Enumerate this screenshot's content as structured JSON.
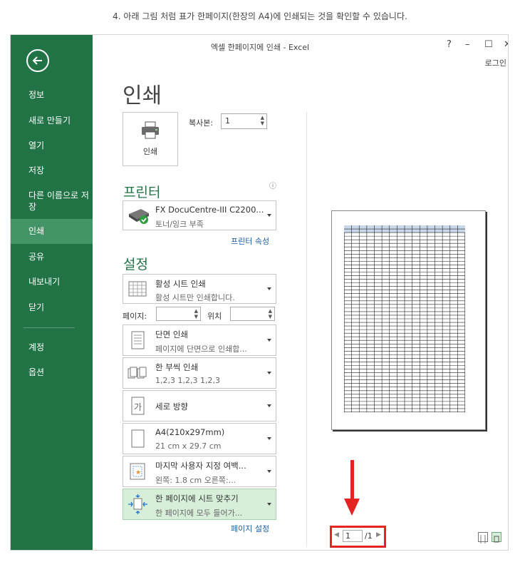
{
  "caption": "4. 아래 그림 처럼 표가 한페이지(한장의 A4)에 인쇄되는 것을 확인할 수 있습니다.",
  "window": {
    "title": "엑셀 한페이지에 인쇄 - Excel",
    "help": "?",
    "minimize": "–",
    "maximize": "☐",
    "close": "✕",
    "login": "로그인"
  },
  "sidebar": {
    "items": [
      {
        "label": "정보"
      },
      {
        "label": "새로 만들기"
      },
      {
        "label": "열기"
      },
      {
        "label": "저장"
      },
      {
        "label": "다른 이름으로 저장"
      },
      {
        "label": "인쇄"
      },
      {
        "label": "공유"
      },
      {
        "label": "내보내기"
      },
      {
        "label": "닫기"
      },
      {
        "label": "계정"
      },
      {
        "label": "옵션"
      }
    ],
    "active_index": 5
  },
  "print": {
    "title": "인쇄",
    "button_label": "인쇄",
    "copies_label": "복사본:",
    "copies_value": "1"
  },
  "printer": {
    "section": "프린터",
    "info": "ⓘ",
    "name": "FX DocuCentre-III C2200...",
    "status": "토너/잉크 부족",
    "properties_link": "프린터 속성"
  },
  "settings": {
    "section": "설정",
    "what": {
      "main": "활성 시트 인쇄",
      "sub": "활성 시트만 인쇄합니다."
    },
    "pages_label": "페이지:",
    "to_label": "위치",
    "sides": {
      "main": "단면 인쇄",
      "sub": "페이지에 단면으로 인쇄합..."
    },
    "collate": {
      "main": "한 부씩 인쇄",
      "sub": "1,2,3    1,2,3    1,2,3"
    },
    "orientation": {
      "main": "세로 방향"
    },
    "paper": {
      "main": "A4(210x297mm)",
      "sub": "21 cm x 29.7 cm"
    },
    "margins": {
      "main": "마지막 사용자 지정 여백...",
      "sub": "왼쪽:  1.8 cm    오른쪽:..."
    },
    "scaling": {
      "main": "한 페이지에 시트 맞추기",
      "sub": "한 페이지에 모두 들어가..."
    },
    "page_setup_link": "페이지 설정"
  },
  "preview": {
    "current_page": "1",
    "total_pages": "/1",
    "grid_rows": 52,
    "grid_cols": 16
  },
  "colors": {
    "accent": "#217346",
    "sidebar_active": "#439467",
    "annotation_red": "#e52421",
    "link": "#1e5fa8"
  }
}
